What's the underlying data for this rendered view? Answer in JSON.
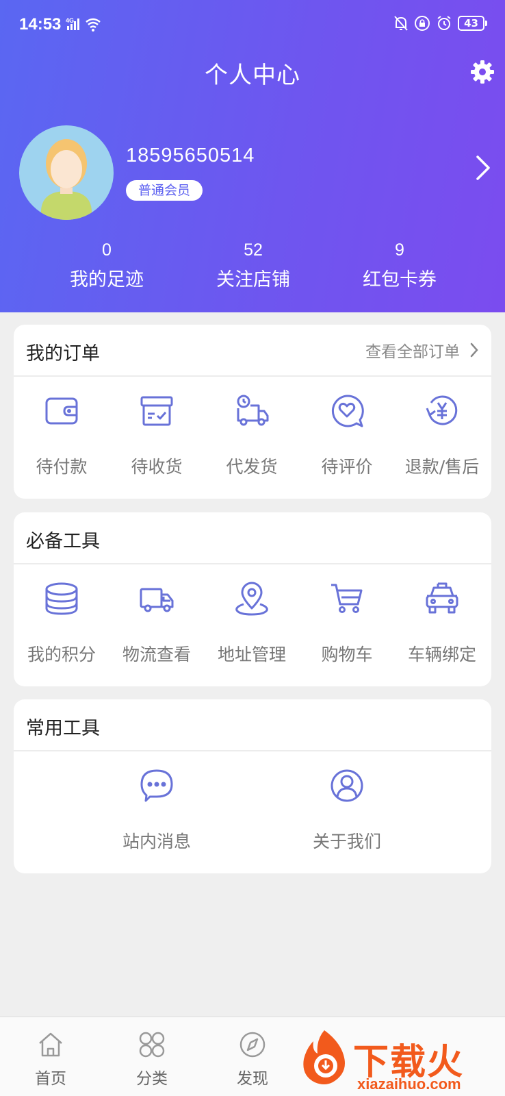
{
  "status_bar": {
    "time": "14:53",
    "network": "4G",
    "battery": "43"
  },
  "header": {
    "title": "个人中心"
  },
  "profile": {
    "phone": "18595650514",
    "member_level": "普通会员"
  },
  "stats": [
    {
      "value": "0",
      "label": "我的足迹"
    },
    {
      "value": "52",
      "label": "关注店铺"
    },
    {
      "value": "9",
      "label": "红包卡券"
    }
  ],
  "orders": {
    "title": "我的订单",
    "view_all": "查看全部订单",
    "items": [
      {
        "label": "待付款",
        "icon": "wallet-icon"
      },
      {
        "label": "待收货",
        "icon": "box-icon"
      },
      {
        "label": "代发货",
        "icon": "delivery-truck-clock-icon"
      },
      {
        "label": "待评价",
        "icon": "heart-chat-icon"
      },
      {
        "label": "退款/售后",
        "icon": "refund-yen-icon"
      }
    ]
  },
  "tools": {
    "title": "必备工具",
    "items": [
      {
        "label": "我的积分",
        "icon": "coins-icon"
      },
      {
        "label": "物流查看",
        "icon": "truck-icon"
      },
      {
        "label": "地址管理",
        "icon": "location-pin-icon"
      },
      {
        "label": "购物车",
        "icon": "cart-icon"
      },
      {
        "label": "车辆绑定",
        "icon": "car-icon"
      }
    ]
  },
  "common_tools": {
    "title": "常用工具",
    "items": [
      {
        "label": "站内消息",
        "icon": "message-icon"
      },
      {
        "label": "关于我们",
        "icon": "user-circle-icon"
      }
    ]
  },
  "bottom_nav": [
    {
      "label": "首页",
      "icon": "home-icon"
    },
    {
      "label": "分类",
      "icon": "category-icon"
    },
    {
      "label": "发现",
      "icon": "compass-icon"
    }
  ],
  "watermark": {
    "title": "下载火",
    "url": "xiazaihuo.com"
  },
  "colors": {
    "header_start": "#5a67f2",
    "header_end": "#7b4cef",
    "icon": "#6872d8",
    "watermark": "#f25a1c"
  }
}
